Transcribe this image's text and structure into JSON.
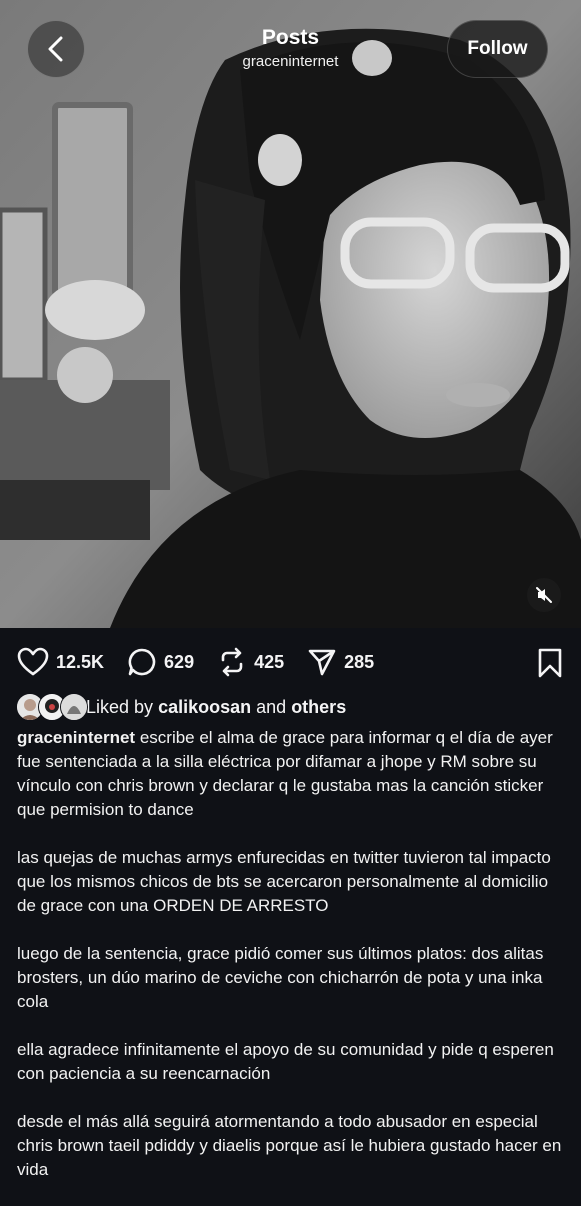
{
  "header": {
    "title": "Posts",
    "username": "graceninternet",
    "follow_label": "Follow"
  },
  "media": {
    "description_icon": "muted-speaker-icon"
  },
  "stats": {
    "likes": "12.5K",
    "comments": "629",
    "reposts": "425",
    "shares": "285"
  },
  "liked_by": {
    "prefix": "Liked by",
    "user": "calikoosan",
    "connector": "and",
    "others": "others"
  },
  "caption": {
    "username": "graceninternet",
    "paragraphs": [
      "escribe el alma de grace para informar q el día de ayer fue sentenciada a la silla eléctrica por difamar a jhope y RM sobre su vínculo con chris brown y declarar q le gustaba mas la canción sticker que permision to dance",
      "las quejas de muchas armys enfurecidas en twitter tuvieron tal impacto que los mismos chicos de bts se acercaron personalmente al domicilio de grace con una ORDEN DE ARRESTO",
      "luego de la sentencia, grace pidió comer sus últimos platos: dos alitas brosters, un dúo marino de ceviche con chicharrón de pota y una inka cola",
      "ella agradece infinitamente el apoyo de su comunidad y pide q esperen con paciencia a su reencarnación",
      "desde el más allá seguirá atormentando a todo abusador en especial chris brown taeil pdiddy y diaelis porque así le hubiera gustado hacer en vida"
    ]
  }
}
